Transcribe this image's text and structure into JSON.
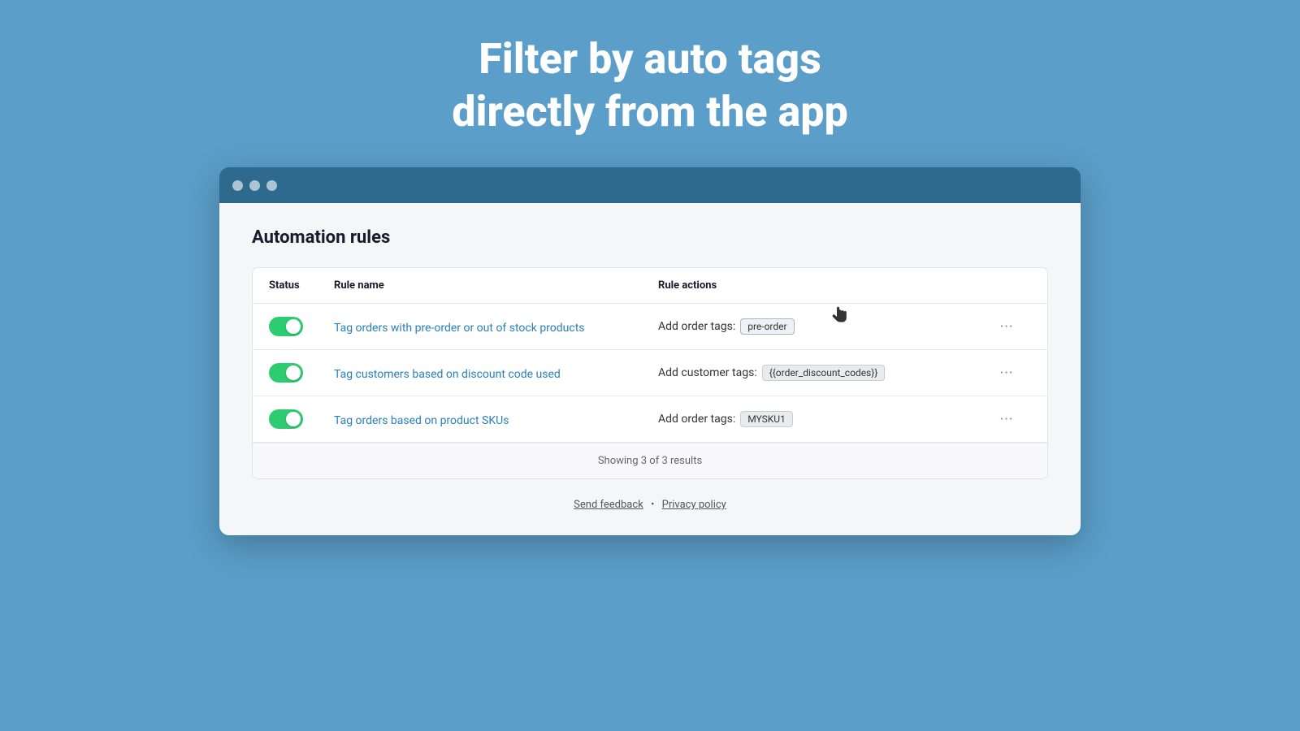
{
  "hero": {
    "line1": "Filter by auto tags",
    "line2": "directly from the app"
  },
  "browser": {
    "dots": [
      "dot1",
      "dot2",
      "dot3"
    ]
  },
  "page": {
    "title": "Automation rules"
  },
  "table": {
    "headers": [
      "Status",
      "Rule name",
      "Rule actions",
      ""
    ],
    "rows": [
      {
        "id": "row1",
        "enabled": true,
        "rule_name": "Tag orders with pre-order or out of stock products",
        "action_label": "Add order tags:",
        "tag": "pre-order",
        "tag_highlighted": true
      },
      {
        "id": "row2",
        "enabled": true,
        "rule_name": "Tag customers based on discount code used",
        "action_label": "Add customer tags:",
        "tag": "{{order_discount_codes}}",
        "tag_highlighted": false
      },
      {
        "id": "row3",
        "enabled": true,
        "rule_name": "Tag orders based on product SKUs",
        "action_label": "Add order tags:",
        "tag": "MYSKU1",
        "tag_highlighted": false
      }
    ],
    "showing_text": "Showing 3 of 3 results"
  },
  "footer": {
    "send_feedback": "Send feedback",
    "separator": "•",
    "privacy_policy": "Privacy policy"
  }
}
